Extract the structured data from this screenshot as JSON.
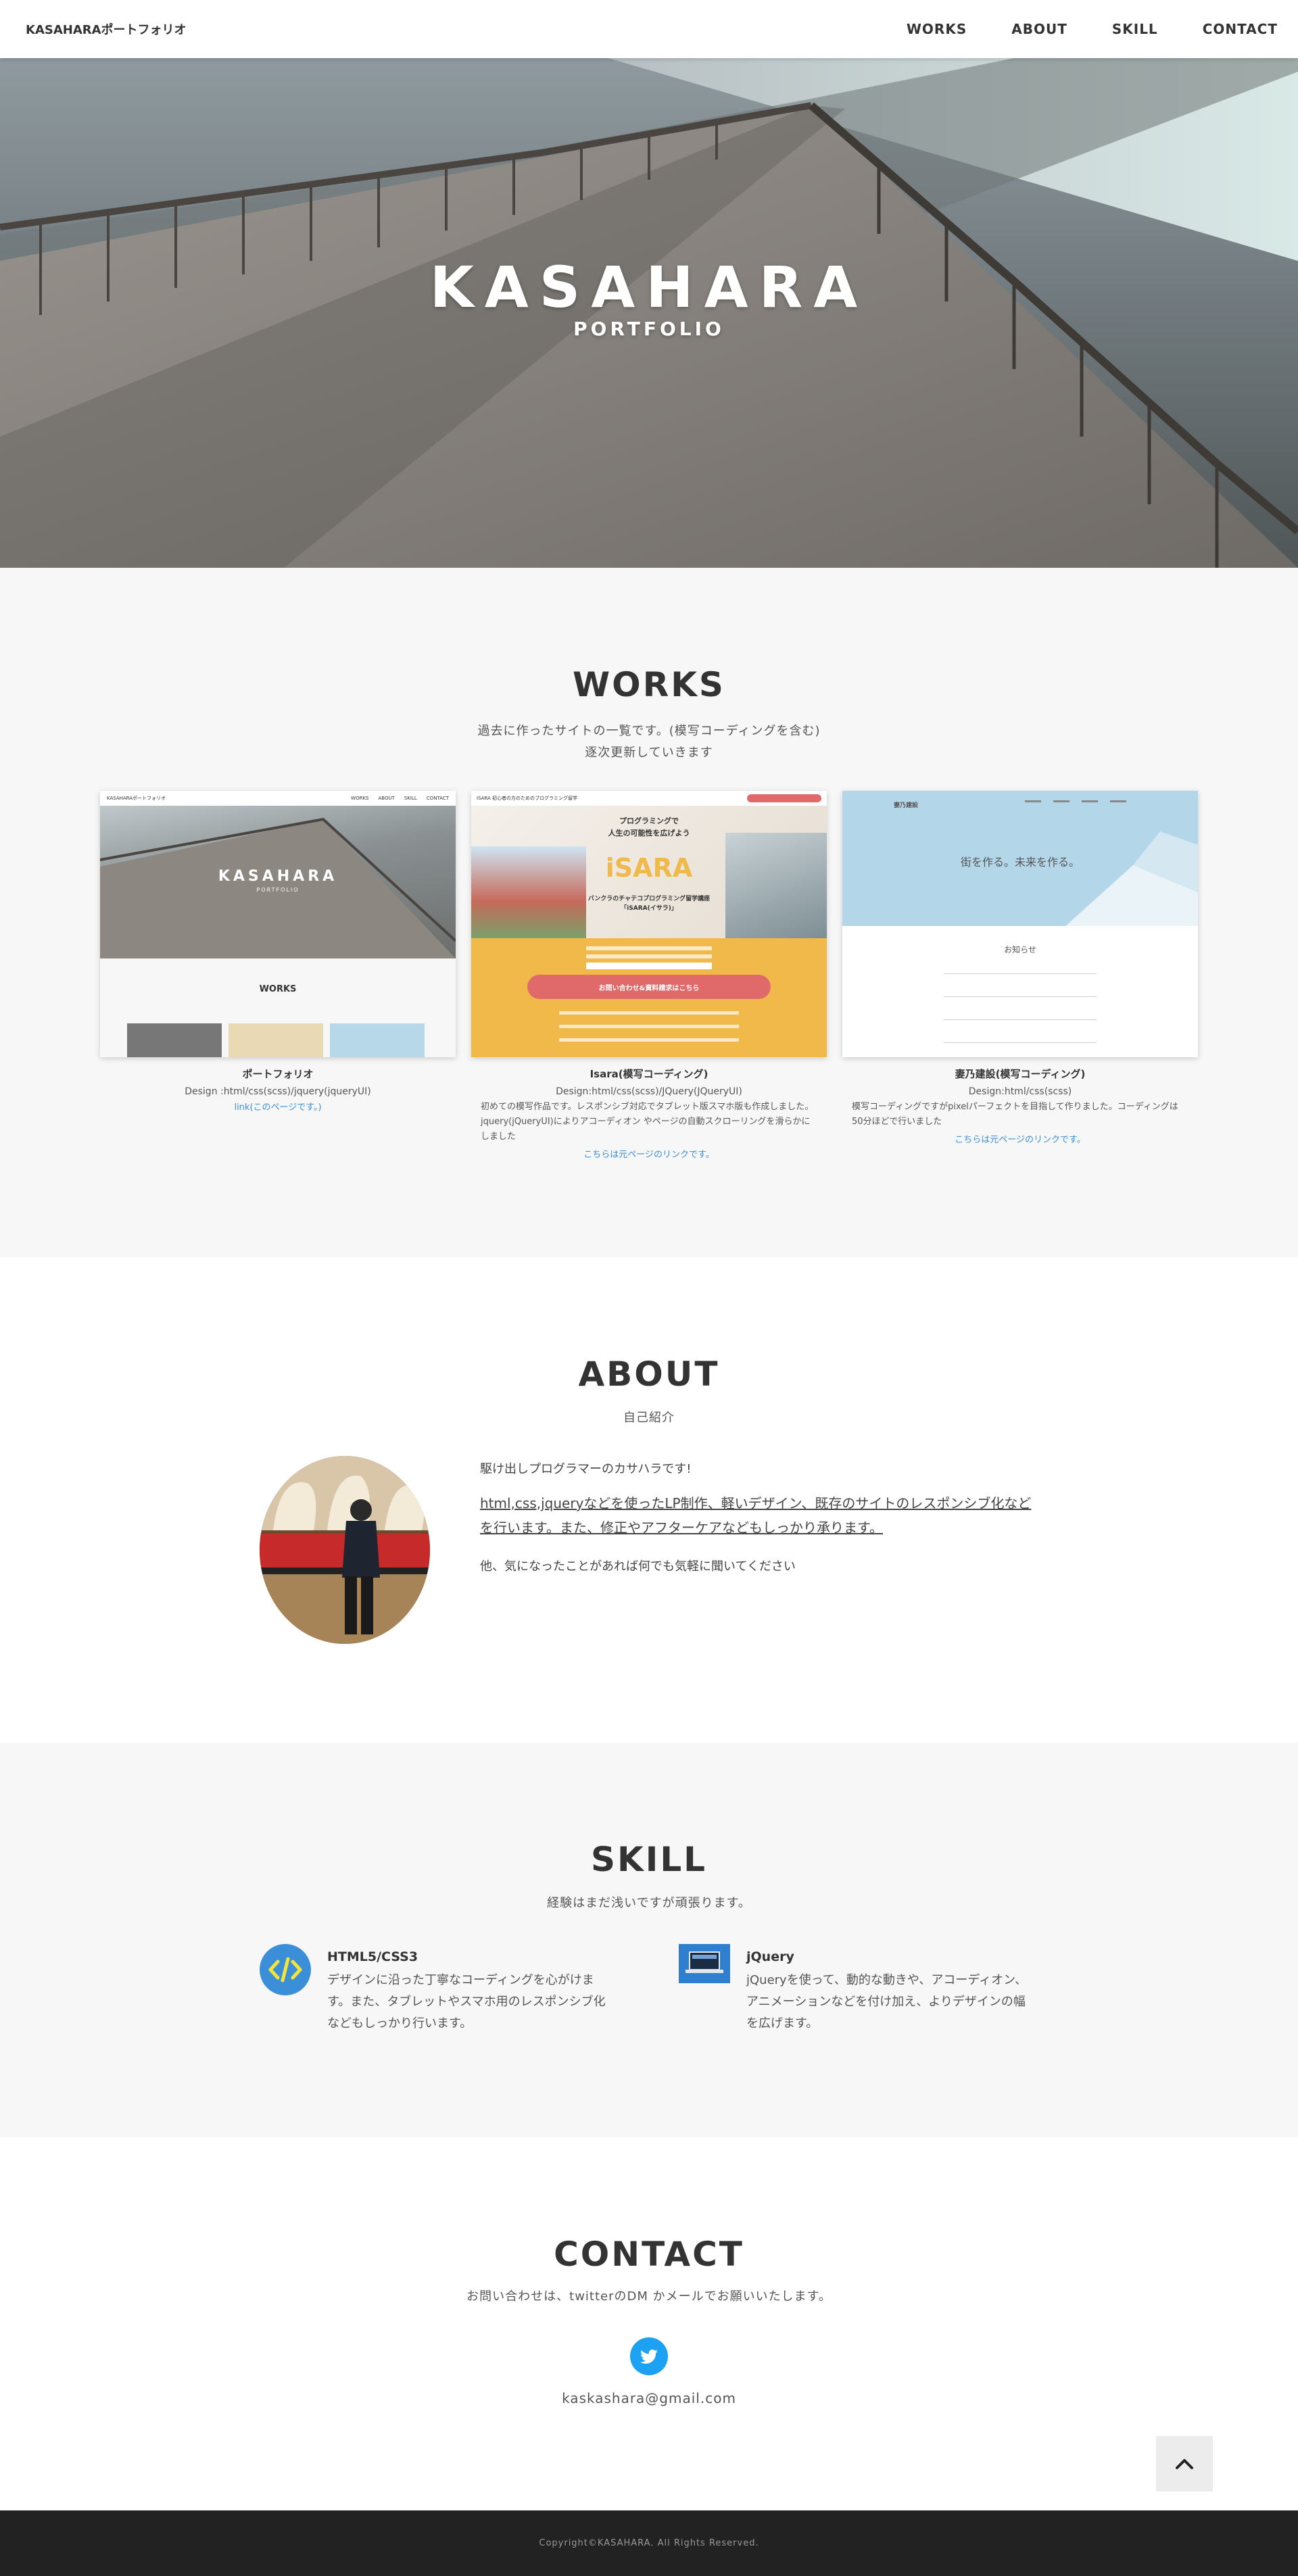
{
  "header": {
    "logo": "KASAHARAポートフォリオ",
    "nav": [
      "WORKS",
      "ABOUT",
      "SKILL",
      "CONTACT"
    ]
  },
  "hero": {
    "title": "KASAHARA",
    "subtitle": "PORTFOLIO"
  },
  "works": {
    "title": "WORKS",
    "desc1": "過去に作ったサイトの一覧です。(模写コーディングを含む)",
    "desc2": "逐次更新していきます",
    "items": [
      {
        "name": "ポートフォリオ",
        "tech": "Design :html/css(scss)/jquery(jqueryUI)",
        "text": "",
        "link": "link(このページです。)",
        "thumb": {
          "logo": "KASAHARAポートフォリオ",
          "nav": [
            "WORKS",
            "ABOUT",
            "SKILL",
            "CONTACT"
          ],
          "hero_title": "KASAHARA",
          "hero_sub": "PORTFOLIO",
          "section_title": "WORKS"
        }
      },
      {
        "name": "Isara(模写コーディング)",
        "tech": "Design:html/css(scss)/JQuery(JQueryUI)",
        "text": "初めての模写作品です。レスポンシブ対応でタブレット版スマホ版も作成しました。jquery(jQueryUI)によりアコーディオン やページの自動スクローリングを滑らかにしました",
        "link": "こちらは元ページのリンクです。",
        "thumb": {
          "header_text": "ISARA 初心者の方のためのプログラミング留学",
          "headline1": "プログラミングで",
          "headline2": "人生の可能性を広げよう",
          "brand": "iSARA",
          "tagline1": "バンクラのチャテコプログラミング留学講座",
          "tagline2": "｢iSARA(イサラ)｣",
          "cta": "お問い合わせ&資料請求はこちら"
        }
      },
      {
        "name": "妻乃建設(模写コーディング)",
        "tech": "Design:html/css(scss)",
        "text": "模写コーディングですがpixelパーフェクトを目指して作りました。コーディングは50分ほどで行いました",
        "link": "こちらは元ページのリンクです。",
        "thumb": {
          "logo": "妻乃建設",
          "hero_copy": "街を作る。未来を作る。",
          "section_title": "お知らせ"
        }
      }
    ]
  },
  "about": {
    "title": "ABOUT",
    "subtitle": "自己紹介",
    "p1": "駆け出しプログラマーのカサハラです!",
    "p2": "html,css,jqueryなどを使ったLP制作、軽いデザイン、既存のサイトのレスポンシブ化などを行います。また、修正やアフターケアなどもしっかり承ります。",
    "p3": "他、気になったことがあれば何でも気軽に聞いてください"
  },
  "skill": {
    "title": "SKILL",
    "subtitle": "経験はまだ浅いですが頑張ります。",
    "items": [
      {
        "name": "HTML5/CSS3",
        "text": "デザインに沿った丁寧なコーディングを心がけます。また、タブレットやスマホ用のレスポンシブ化などもしっかり行います。",
        "icon": "code-icon"
      },
      {
        "name": "jQuery",
        "text": "jQueryを使って、動的な動きや、アコーディオン、アニメーションなどを付け加え、よりデザインの幅を広げます。",
        "icon": "jquery-icon"
      }
    ]
  },
  "contact": {
    "title": "CONTACT",
    "subtitle": "お問い合わせは、twitterのDM かメールでお願いいたします。",
    "email": "kaskashara@gmail.com"
  },
  "footer": {
    "copyright": "Copyright©KASAHARA. All Rights Reserved."
  },
  "colors": {
    "accent_link": "#3b8dd4",
    "twitter": "#1da1f2",
    "isara_orange": "#f0b94a",
    "isara_cta": "#e06a6a",
    "footer_bg": "#222222"
  }
}
